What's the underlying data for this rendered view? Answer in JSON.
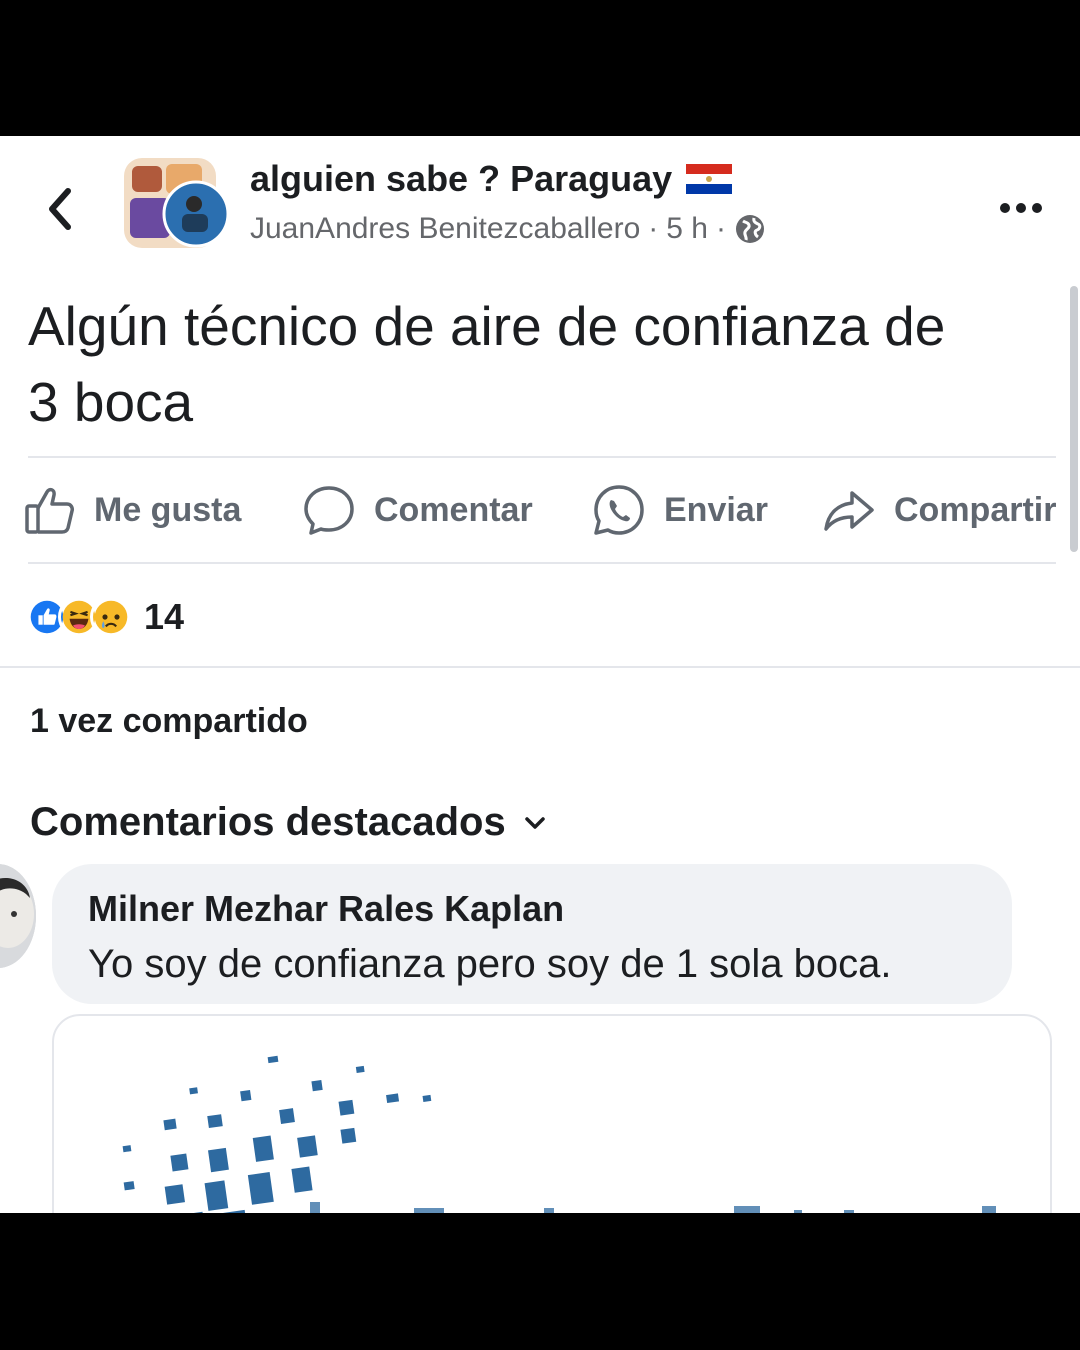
{
  "post": {
    "group_name": "alguien sabe ? Paraguay",
    "author": "JuanAndres Benitezcaballero",
    "separator": "·",
    "time": "5 h",
    "text_line1": "Algún técnico de aire de confianza de",
    "text_line2": "3 boca"
  },
  "actions": {
    "like": "Me gusta",
    "comment": "Comentar",
    "send": "Enviar",
    "share": "Compartir"
  },
  "reactions": {
    "count": "14",
    "types": [
      "like",
      "haha",
      "sad"
    ]
  },
  "shares_text": "1 vez compartido",
  "comments": {
    "sort_label": "Comentarios destacados",
    "items": [
      {
        "author": "Milner Mezhar Rales Kaplan",
        "text": "Yo soy de confianza pero soy de 1 sola boca."
      }
    ]
  },
  "icons": {
    "back": "chevron-left-icon",
    "more": "more-horizontal-icon",
    "audience": "globe-icon",
    "like": "thumbs-up-icon",
    "comment": "speech-bubble-icon",
    "send": "whatsapp-icon",
    "share": "share-arrow-icon",
    "sort": "chevron-down-icon"
  },
  "colors": {
    "like_blue": "#1877f2",
    "emoji_yellow": "#f7b928",
    "text_secondary": "#65676b",
    "bubble_bg": "#f0f2f5",
    "logo_blue": "#2e6aa0"
  }
}
